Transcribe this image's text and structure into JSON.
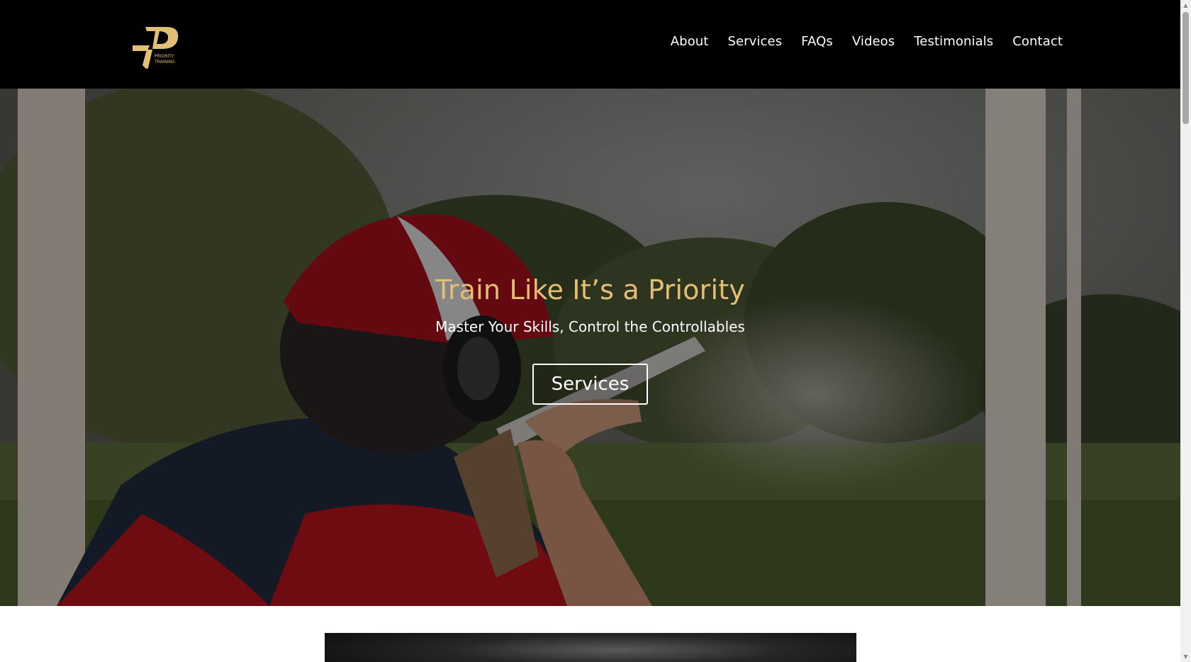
{
  "brand": {
    "logo_icon": "priority-training-logo-icon",
    "logo_text": "PRIORITY TRAINING",
    "accent_color": "#e2bf74"
  },
  "nav": {
    "items": [
      {
        "label": "About"
      },
      {
        "label": "Services"
      },
      {
        "label": "FAQs"
      },
      {
        "label": "Videos"
      },
      {
        "label": "Testimonials"
      },
      {
        "label": "Contact"
      }
    ]
  },
  "hero": {
    "title": "Train Like It’s a Priority",
    "subtitle": "Master Your Skills, Control the Controllables",
    "button_label": "Services"
  },
  "scrollbar": {
    "up_icon": "arrow-up-icon",
    "down_icon": "arrow-down-icon"
  }
}
